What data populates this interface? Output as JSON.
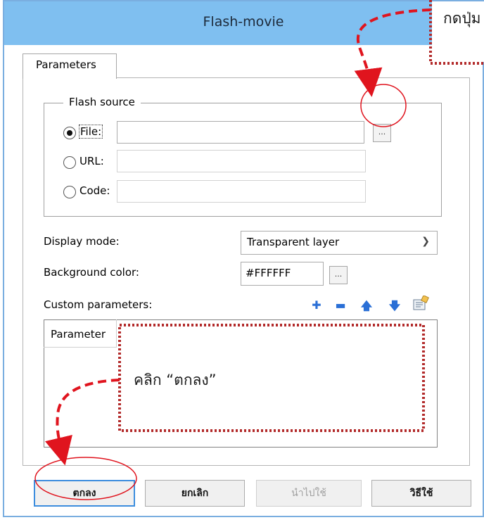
{
  "dialog": {
    "title": "Flash-movie",
    "tab_label": "Parameters",
    "group_label": "Flash source",
    "source_options": [
      {
        "label": "File:",
        "selected": true,
        "value": ""
      },
      {
        "label": "URL:",
        "selected": false,
        "value": ""
      },
      {
        "label": "Code:",
        "selected": false,
        "value": ""
      }
    ],
    "browse_label": "...",
    "display_mode_label": "Display mode:",
    "display_mode_value": "Transparent layer",
    "background_color_label": "Background color:",
    "background_color_value": "#FFFFFF",
    "custom_params_label": "Custom parameters:",
    "params_column_header": "Parameter",
    "buttons": {
      "ok": "ตกลง",
      "cancel": "ยกเลิก",
      "apply": "นำไปใช้",
      "help": "วิธีใช้"
    }
  },
  "annotations": {
    "top_note": "กดปุ่ม",
    "middle_note": "คลิก “ตกลง”",
    "color": "#e0141e"
  },
  "colors": {
    "titlebar": "#7fbff0",
    "window_border": "#7aaee0",
    "icon_blue": "#2a6fd6"
  }
}
